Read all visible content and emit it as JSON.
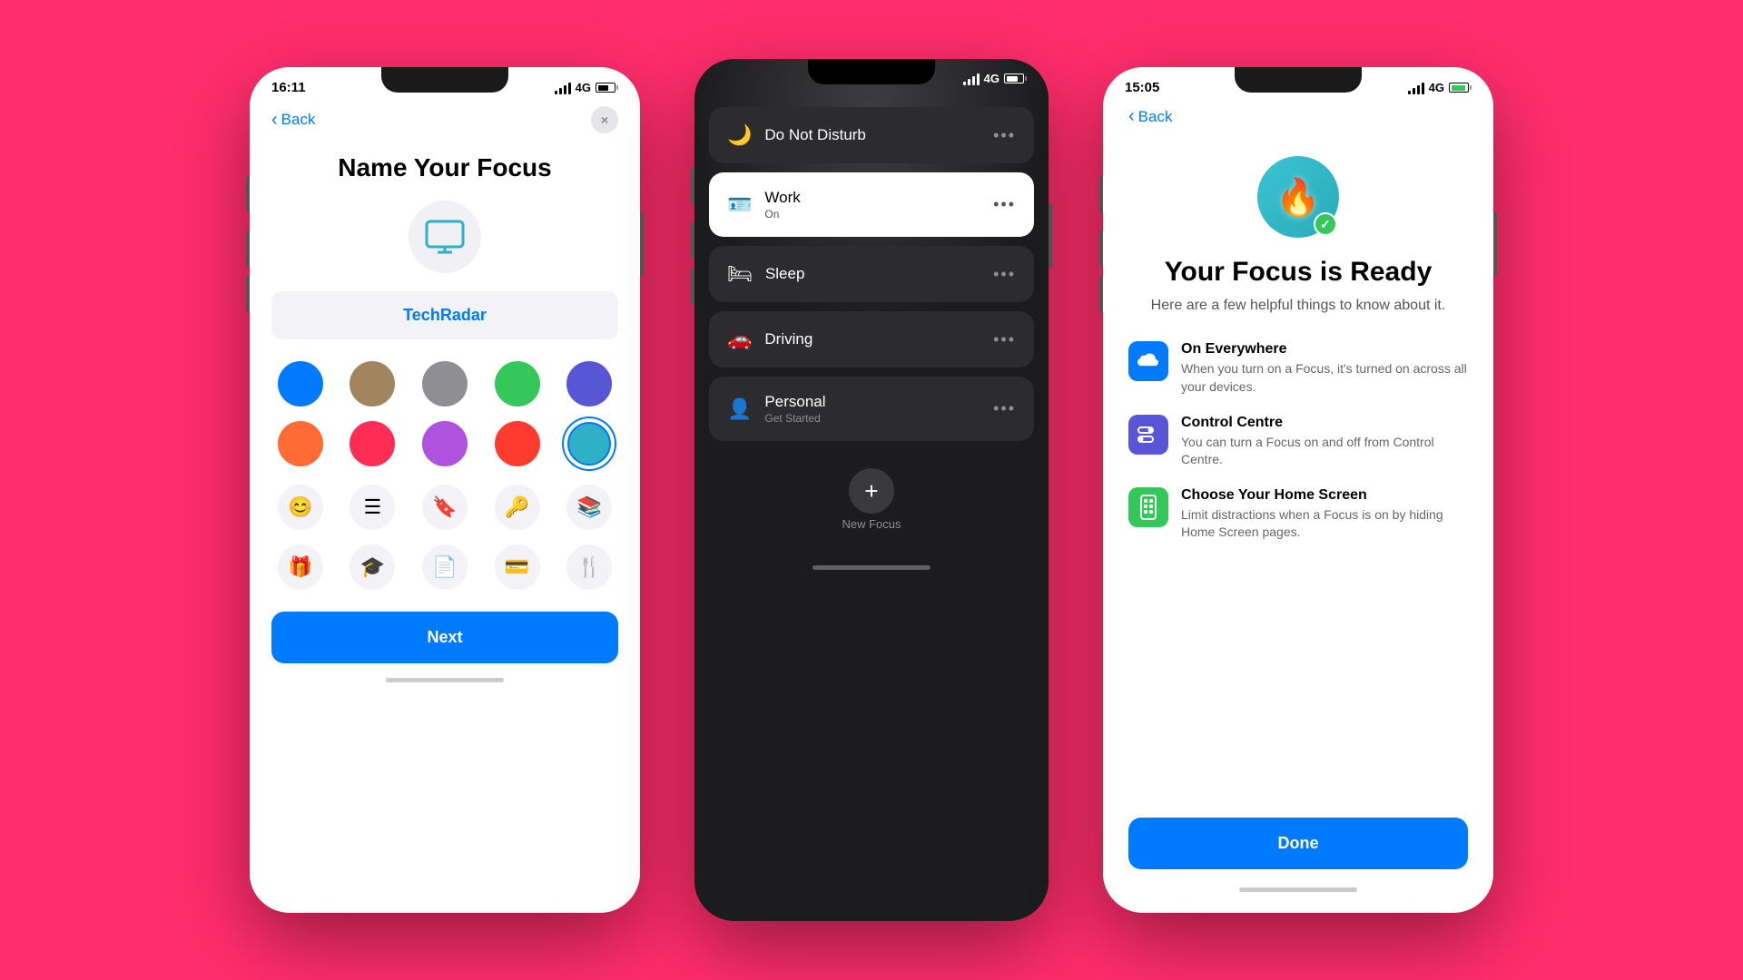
{
  "background": "#FF2D6B",
  "phone1": {
    "status": {
      "time": "16:11",
      "signal": "4G",
      "battery": 80
    },
    "nav": {
      "back_label": "Back",
      "close_label": "×"
    },
    "title": "Name Your Focus",
    "input_value": "TechRadar",
    "colors": [
      {
        "hex": "#007AFF",
        "selected": false
      },
      {
        "hex": "#A2845E",
        "selected": false
      },
      {
        "hex": "#8E8E93",
        "selected": false
      },
      {
        "hex": "#34C759",
        "selected": false
      },
      {
        "hex": "#5856D6",
        "selected": false
      },
      {
        "hex": "#FF6B35",
        "selected": false
      },
      {
        "hex": "#FF2D55",
        "selected": false
      },
      {
        "hex": "#AF52DE",
        "selected": false
      },
      {
        "hex": "#FF3B30",
        "selected": false
      },
      {
        "hex": "#30B0C7",
        "selected": true
      }
    ],
    "icons": [
      "😊",
      "☰",
      "🔖",
      "🔑",
      "📚",
      "🎁",
      "🎓",
      "📄",
      "💳",
      "🍴"
    ],
    "next_label": "Next"
  },
  "phone2": {
    "status": {
      "time": "",
      "signal": "4G"
    },
    "focus_items": [
      {
        "icon": "🌙",
        "name": "Do Not Disturb",
        "sub": "",
        "active": false
      },
      {
        "icon": "🪪",
        "name": "Work",
        "sub": "On",
        "active": true
      },
      {
        "icon": "🛏",
        "name": "Sleep",
        "sub": "",
        "active": false
      },
      {
        "icon": "🚗",
        "name": "Driving",
        "sub": "",
        "active": false
      },
      {
        "icon": "👤",
        "name": "Personal",
        "sub": "Get Started",
        "active": false
      }
    ],
    "add_label": "New Focus",
    "add_icon": "+"
  },
  "phone3": {
    "status": {
      "time": "15:05",
      "signal": "4G"
    },
    "nav": {
      "back_label": "Back"
    },
    "title": "Your Focus is Ready",
    "subtitle": "Here are a few helpful things to know about it.",
    "features": [
      {
        "icon": "☁",
        "color": "blue",
        "title": "On Everywhere",
        "desc": "When you turn on a Focus, it's turned on across all your devices."
      },
      {
        "icon": "⚙",
        "color": "indigo",
        "title": "Control Centre",
        "desc": "You can turn a Focus on and off from Control Centre."
      },
      {
        "icon": "📱",
        "color": "green",
        "title": "Choose Your Home Screen",
        "desc": "Limit distractions when a Focus is on by hiding Home Screen pages."
      }
    ],
    "done_label": "Done"
  }
}
